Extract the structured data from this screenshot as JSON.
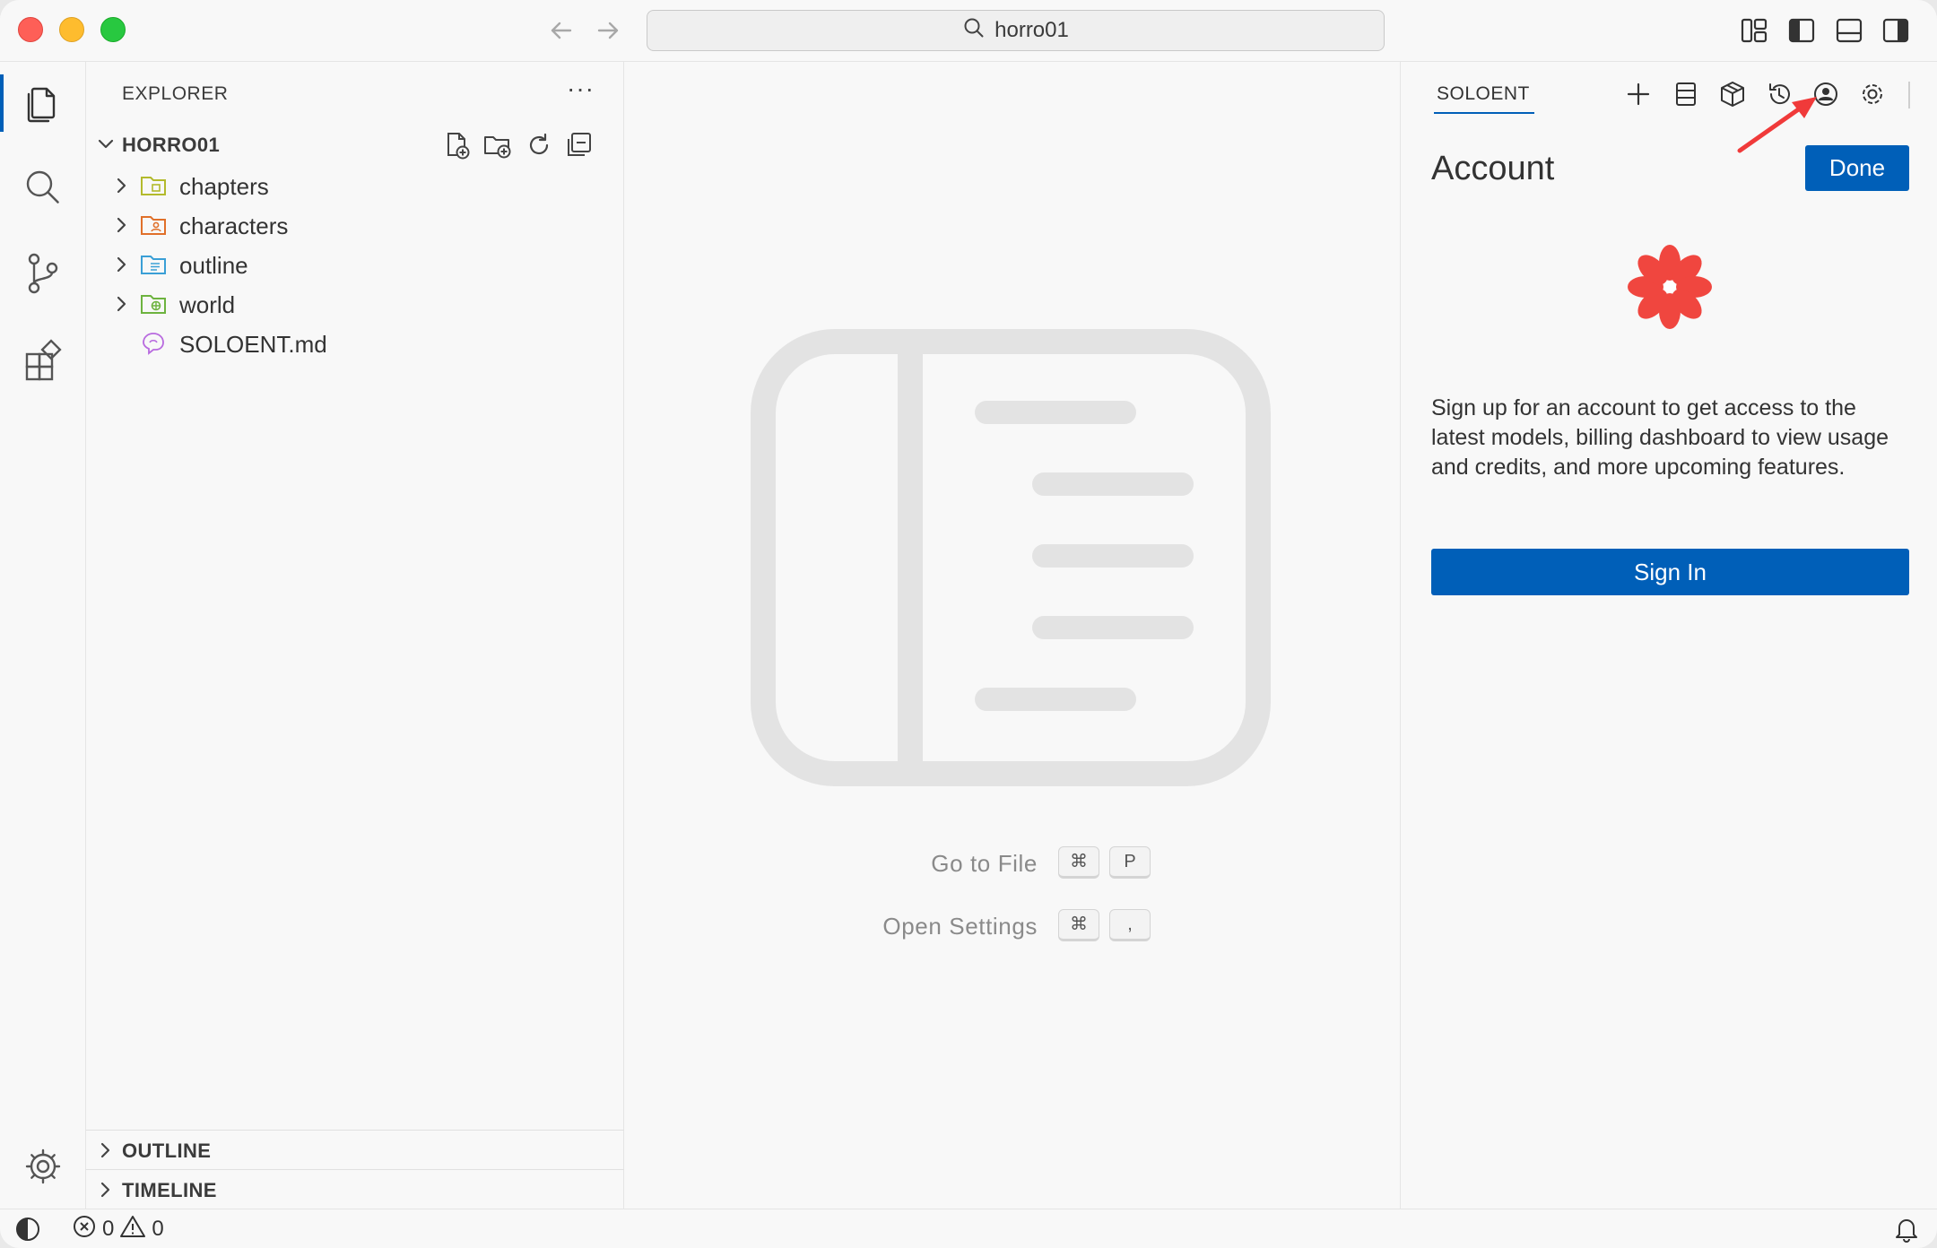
{
  "titlebar": {
    "search_text": "horro01"
  },
  "explorer": {
    "title": "EXPLORER",
    "more": "···",
    "root_label": "HORRO01",
    "items": [
      {
        "label": "chapters",
        "icon": "folder-chapters-icon",
        "color": "#b3ba2c",
        "expandable": true
      },
      {
        "label": "characters",
        "icon": "folder-characters-icon",
        "color": "#e0702a",
        "expandable": true
      },
      {
        "label": "outline",
        "icon": "folder-outline-icon",
        "color": "#3a9fd6",
        "expandable": true
      },
      {
        "label": "world",
        "icon": "folder-world-icon",
        "color": "#6db33f",
        "expandable": true
      },
      {
        "label": "SOLOENT.md",
        "icon": "soloent-file-icon",
        "color": "#b86adf",
        "expandable": false
      }
    ],
    "sections": [
      {
        "label": "OUTLINE"
      },
      {
        "label": "TIMELINE"
      }
    ]
  },
  "editor": {
    "hints": [
      {
        "label": "Go to File",
        "keys": [
          "⌘",
          "P"
        ]
      },
      {
        "label": "Open Settings",
        "keys": [
          "⌘",
          ","
        ]
      }
    ]
  },
  "panel": {
    "tab": "SOLOENT",
    "account_title": "Account",
    "done_label": "Done",
    "description": "Sign up for an account to get access to the latest models, billing dashboard to view usage and credits, and more upcoming features.",
    "signin_label": "Sign In",
    "accent_color": "#005fb8",
    "logo_color": "#f0463f"
  },
  "statusbar": {
    "errors": "0",
    "warnings": "0"
  }
}
